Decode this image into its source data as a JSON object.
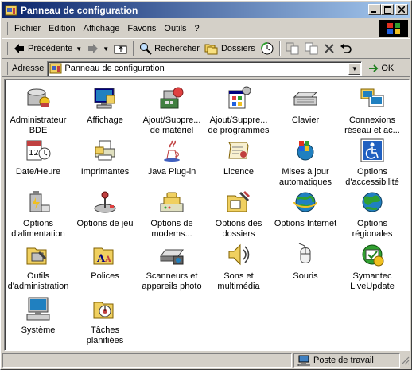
{
  "window": {
    "title": "Panneau de configuration"
  },
  "menubar": {
    "items": [
      {
        "label": "Fichier"
      },
      {
        "label": "Edition"
      },
      {
        "label": "Affichage"
      },
      {
        "label": "Favoris"
      },
      {
        "label": "Outils"
      },
      {
        "label": "?"
      }
    ]
  },
  "toolbar": {
    "back_label": "Précédente",
    "search_label": "Rechercher",
    "folders_label": "Dossiers"
  },
  "address": {
    "label": "Adresse",
    "value": "Panneau de configuration",
    "go_label": "OK"
  },
  "items": [
    {
      "label": "Administrateur\nBDE",
      "icon": "bde-admin-icon"
    },
    {
      "label": "Affichage",
      "icon": "display-icon"
    },
    {
      "label": "Ajout/Suppre...\nde matériel",
      "icon": "add-hardware-icon"
    },
    {
      "label": "Ajout/Suppre...\nde programmes",
      "icon": "add-programs-icon"
    },
    {
      "label": "Clavier",
      "icon": "keyboard-icon"
    },
    {
      "label": "Connexions\nréseau et ac...",
      "icon": "network-icon"
    },
    {
      "label": "Date/Heure",
      "icon": "date-time-icon"
    },
    {
      "label": "Imprimantes",
      "icon": "printers-icon"
    },
    {
      "label": "Java Plug-in",
      "icon": "java-icon"
    },
    {
      "label": "Licence",
      "icon": "license-icon"
    },
    {
      "label": "Mises à jour\nautomatiques",
      "icon": "windows-update-icon"
    },
    {
      "label": "Options\nd'accessibilité",
      "icon": "accessibility-icon"
    },
    {
      "label": "Options\nd'alimentation",
      "icon": "power-icon"
    },
    {
      "label": "Options de jeu",
      "icon": "joystick-icon"
    },
    {
      "label": "Options de\nmodems...",
      "icon": "modem-icon"
    },
    {
      "label": "Options des\ndossiers",
      "icon": "folder-options-icon"
    },
    {
      "label": "Options Internet",
      "icon": "internet-options-icon"
    },
    {
      "label": "Options\nrégionales",
      "icon": "regional-icon"
    },
    {
      "label": "Outils\nd'administration",
      "icon": "admin-tools-icon"
    },
    {
      "label": "Polices",
      "icon": "fonts-icon"
    },
    {
      "label": "Scanneurs et\nappareils photo",
      "icon": "scanner-icon"
    },
    {
      "label": "Sons et\nmultimédia",
      "icon": "sound-icon"
    },
    {
      "label": "Souris",
      "icon": "mouse-icon"
    },
    {
      "label": "Symantec\nLiveUpdate",
      "icon": "liveupdate-icon"
    },
    {
      "label": "Système",
      "icon": "system-icon"
    },
    {
      "label": "Tâches\nplanifiées",
      "icon": "scheduled-tasks-icon"
    }
  ],
  "statusbar": {
    "zone": "Poste de travail"
  }
}
